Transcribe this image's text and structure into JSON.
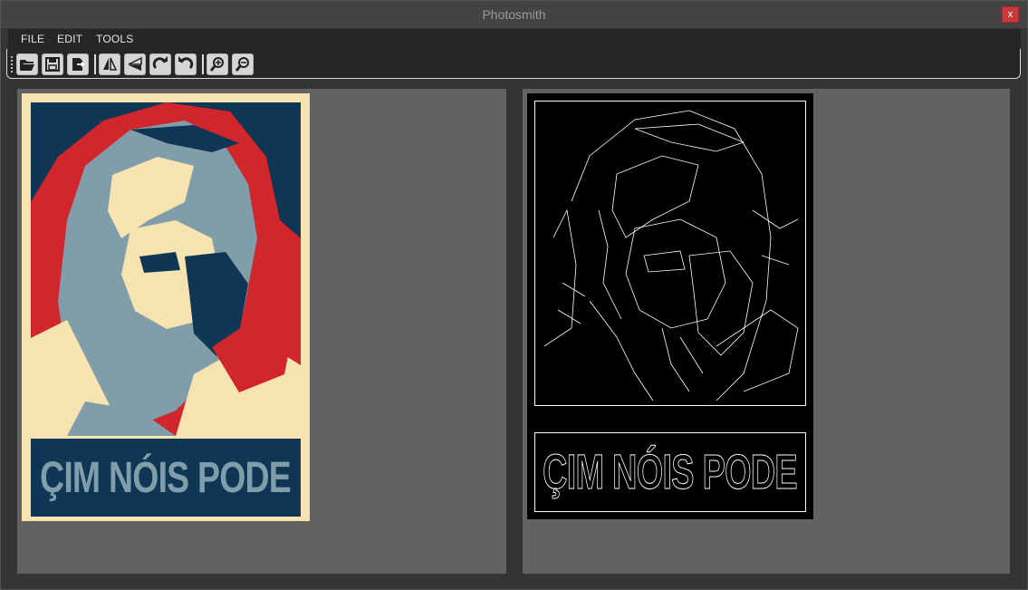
{
  "window": {
    "title": "Photosmith",
    "close_label": "x"
  },
  "menu": [
    "FILE",
    "EDIT",
    "TOOLS"
  ],
  "toolbar": {
    "buttons": [
      {
        "icon": "open-folder-icon"
      },
      {
        "icon": "save-icon"
      },
      {
        "icon": "export-icon"
      },
      {
        "icon": "flip-horizontal-icon"
      },
      {
        "icon": "flip-vertical-icon"
      },
      {
        "icon": "rotate-right-icon"
      },
      {
        "icon": "rotate-left-icon"
      },
      {
        "icon": "zoom-in-icon"
      },
      {
        "icon": "zoom-out-icon"
      }
    ]
  },
  "original_image": {
    "caption": "ÇIM NÓIS PODE"
  },
  "processed_image": {
    "caption": "ÇIM NÓIS PODE",
    "filter": "edge detection"
  },
  "colors": {
    "poster_red": "#d0262c",
    "poster_blue": "#0f3654",
    "poster_grey": "#7f9ea9",
    "poster_cream": "#f6e3b0"
  }
}
